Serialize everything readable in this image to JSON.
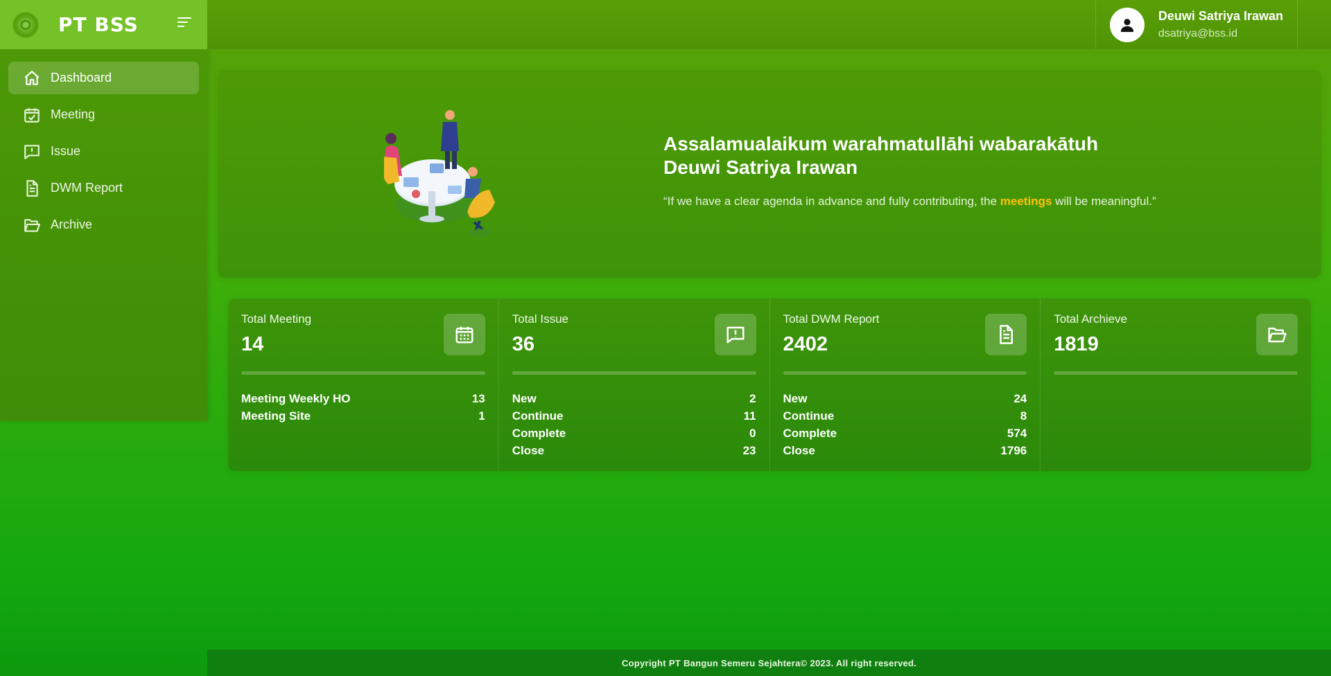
{
  "brand": {
    "name": "PT BSS"
  },
  "sidebar": {
    "items": [
      {
        "label": "Dashboard",
        "icon": "home-icon",
        "active": true
      },
      {
        "label": "Meeting",
        "icon": "calendar-check-icon"
      },
      {
        "label": "Issue",
        "icon": "message-alert-icon"
      },
      {
        "label": "DWM Report",
        "icon": "document-icon"
      },
      {
        "label": "Archive",
        "icon": "folder-open-icon"
      }
    ]
  },
  "user": {
    "name": "Deuwi Satriya Irawan",
    "email": "dsatriya@bss.id"
  },
  "hero": {
    "greeting_line1": "Assalamualaikum warahmatullāhi wabarakātuh",
    "greeting_line2": "Deuwi Satriya Irawan",
    "quote_before": "“If we have a clear agenda in advance and fully contributing, the ",
    "quote_highlight": "meetings",
    "quote_after": " will be meaningful.”",
    "highlight_color": "#ffc107"
  },
  "stats": [
    {
      "title": "Total Meeting",
      "value": "14",
      "icon": "calendar-icon",
      "rows": [
        {
          "label": "Meeting Weekly HO",
          "value": "13"
        },
        {
          "label": "Meeting Site",
          "value": "1"
        }
      ]
    },
    {
      "title": "Total Issue",
      "value": "36",
      "icon": "message-alert-icon",
      "rows": [
        {
          "label": "New",
          "value": "2"
        },
        {
          "label": "Continue",
          "value": "11"
        },
        {
          "label": "Complete",
          "value": "0"
        },
        {
          "label": "Close",
          "value": "23"
        }
      ]
    },
    {
      "title": "Total DWM Report",
      "value": "2402",
      "icon": "document-icon",
      "rows": [
        {
          "label": "New",
          "value": "24"
        },
        {
          "label": "Continue",
          "value": "8"
        },
        {
          "label": "Complete",
          "value": "574"
        },
        {
          "label": "Close",
          "value": "1796"
        }
      ]
    },
    {
      "title": "Total Archieve",
      "value": "1819",
      "icon": "folder-open-icon",
      "rows": []
    }
  ],
  "footer": {
    "text": "Copyright PT Bangun Semeru Sejahtera© 2023. All right reserved."
  }
}
